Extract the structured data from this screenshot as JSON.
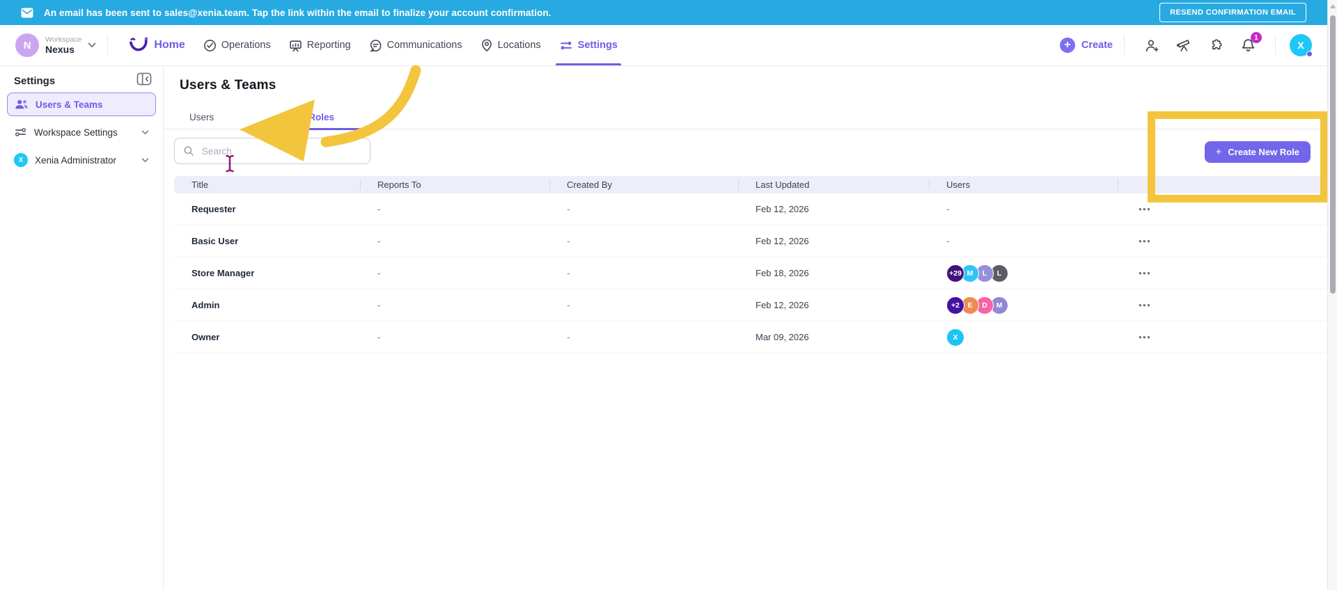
{
  "banner": {
    "message": "An email has been sent to sales@xenia.team. Tap the link within the email to finalize your account confirmation.",
    "resend_button": "RESEND CONFIRMATION EMAIL"
  },
  "topnav": {
    "workspace_label": "Workspace",
    "workspace_name": "Nexus",
    "workspace_initial": "N",
    "items": [
      {
        "label": "Home"
      },
      {
        "label": "Operations"
      },
      {
        "label": "Reporting"
      },
      {
        "label": "Communications"
      },
      {
        "label": "Locations"
      },
      {
        "label": "Settings"
      }
    ],
    "create_label": "Create",
    "notification_count": "1",
    "user_initial": "X"
  },
  "sidebar": {
    "title": "Settings",
    "items": [
      {
        "label": "Users & Teams"
      },
      {
        "label": "Workspace Settings"
      },
      {
        "label": "Xenia Administrator",
        "initial": "X"
      }
    ]
  },
  "main": {
    "title": "Users & Teams",
    "tabs": [
      {
        "label": "Users"
      },
      {
        "label": "Roles"
      }
    ],
    "search_placeholder": "Search",
    "create_role_button": "Create New Role",
    "table": {
      "columns": [
        "Title",
        "Reports To",
        "Created By",
        "Last Updated",
        "Users"
      ],
      "actions_glyph": "•••",
      "rows": [
        {
          "title": "Requester",
          "reports_to": "-",
          "created_by": "-",
          "last_updated": "Feb 12, 2026",
          "users_placeholder": "-",
          "users": []
        },
        {
          "title": "Basic User",
          "reports_to": "-",
          "created_by": "-",
          "last_updated": "Feb 12, 2026",
          "users_placeholder": "-",
          "users": []
        },
        {
          "title": "Store Manager",
          "reports_to": "-",
          "created_by": "-",
          "last_updated": "Feb 18, 2026",
          "users": [
            {
              "text": "+29",
              "color": "#41137E"
            },
            {
              "text": "M",
              "color": "#2EC6F6"
            },
            {
              "text": "L",
              "color": "#988FDC"
            },
            {
              "text": "L",
              "color": "#5C5C66"
            }
          ]
        },
        {
          "title": "Admin",
          "reports_to": "-",
          "created_by": "-",
          "last_updated": "Feb 12, 2026",
          "users": [
            {
              "text": "+2",
              "color": "#4413A0"
            },
            {
              "text": "E",
              "color": "#EF8A52"
            },
            {
              "text": "D",
              "color": "#F763A4"
            },
            {
              "text": "M",
              "color": "#9287D2"
            }
          ]
        },
        {
          "title": "Owner",
          "reports_to": "-",
          "created_by": "-",
          "last_updated": "Mar 09, 2026",
          "users": [
            {
              "text": "X",
              "color": "#1CC4F4"
            }
          ]
        }
      ]
    }
  },
  "colors": {
    "banner_bg": "#27AAE1",
    "accent_purple": "#6C5CE7",
    "annotation_yellow": "#F2C53D",
    "badge_magenta": "#C62BC5"
  }
}
